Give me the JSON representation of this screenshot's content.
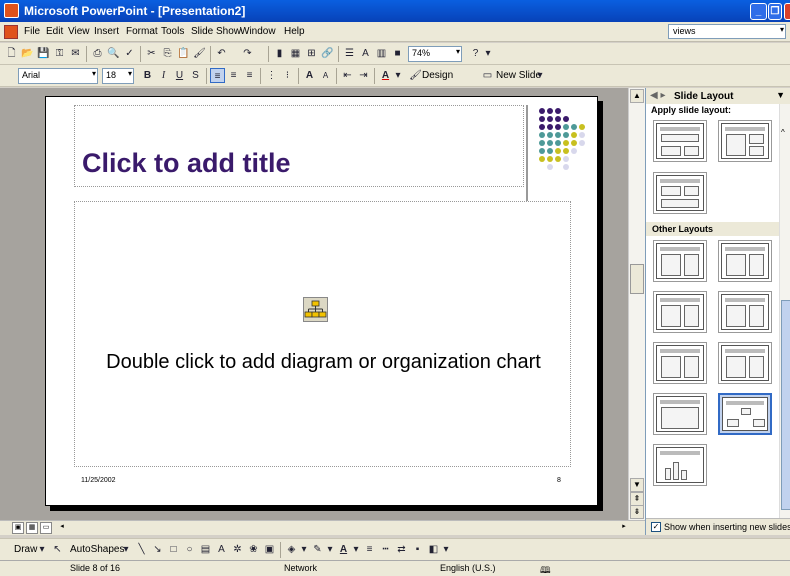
{
  "window": {
    "title": "Microsoft PowerPoint - [Presentation2]"
  },
  "menu": [
    "File",
    "Edit",
    "View",
    "Insert",
    "Format",
    "Tools",
    "Slide Show",
    "Window",
    "Help"
  ],
  "help_box": {
    "value": "views"
  },
  "toolbar": {
    "zoom": "74%"
  },
  "formatting": {
    "font": "Arial",
    "size": "18",
    "design_label": "Design",
    "new_slide_label": "New Slide"
  },
  "slide": {
    "title_placeholder": "Click to add title",
    "content_placeholder": "Double click to add diagram or organization chart",
    "date": "11/25/2002",
    "page_number": "8"
  },
  "task_pane": {
    "title": "Slide Layout",
    "apply_label": "Apply slide layout:",
    "other_label": "Other Layouts",
    "show_checkbox_label": "Show when inserting new slides",
    "show_checked": true
  },
  "drawing": {
    "draw_label": "Draw",
    "autoshapes_label": "AutoShapes"
  },
  "status": {
    "slide": "Slide 8 of 16",
    "design": "Network",
    "language": "English (U.S.)"
  },
  "colors": {
    "title_purple": "#3a1a6b",
    "titlebar_blue": "#0a5fe0",
    "selection_blue": "#316ac5"
  }
}
